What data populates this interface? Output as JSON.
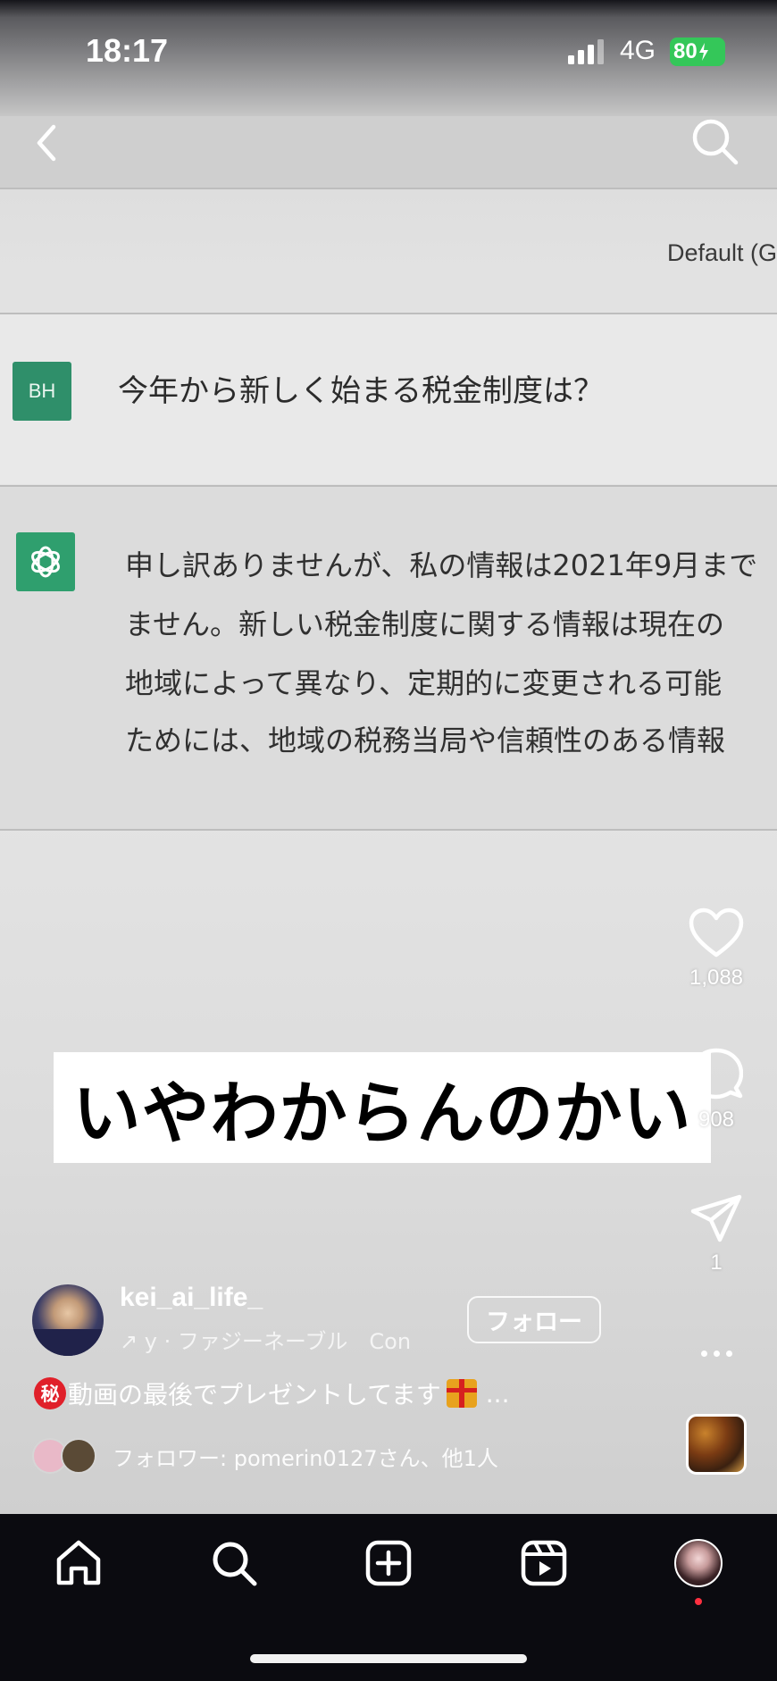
{
  "status_bar": {
    "time": "18:17",
    "network": "4G",
    "battery": "80"
  },
  "video": {
    "model_label": "Default (G",
    "user_avatar_initials": "BH",
    "user_question": "今年から新しく始まる税金制度は？",
    "bot_lines": [
      "申し訳ありませんが、私の情報は2021年9月まで",
      "ません。新しい税金制度に関する情報は現在の",
      "地域によって異なり、定期的に変更される可能",
      "ためには、地域の税務当局や信頼性のある情報"
    ],
    "overlay_caption": "いやわからんのかい"
  },
  "actions": {
    "likes": "1,088",
    "comments": "908",
    "shares": "1"
  },
  "post": {
    "username": "kei_ai_life_",
    "audio": "↗ у · ファジーネーブル　Con",
    "follow_label": "フォロー",
    "secret_badge": "秘",
    "caption": "動画の最後でプレゼントしてます",
    "caption_more": "...",
    "followers_text": "フォロワー: pomerin0127さん、他1人"
  },
  "colors": {
    "battery": "#34c759",
    "gpt_green": "#2f9f6e",
    "notification_dot": "#ff3040"
  },
  "icons": [
    "back-icon",
    "search-icon",
    "heart-icon",
    "comment-icon",
    "send-icon",
    "more-icon",
    "home-icon",
    "explore-icon",
    "create-icon",
    "reels-icon"
  ]
}
